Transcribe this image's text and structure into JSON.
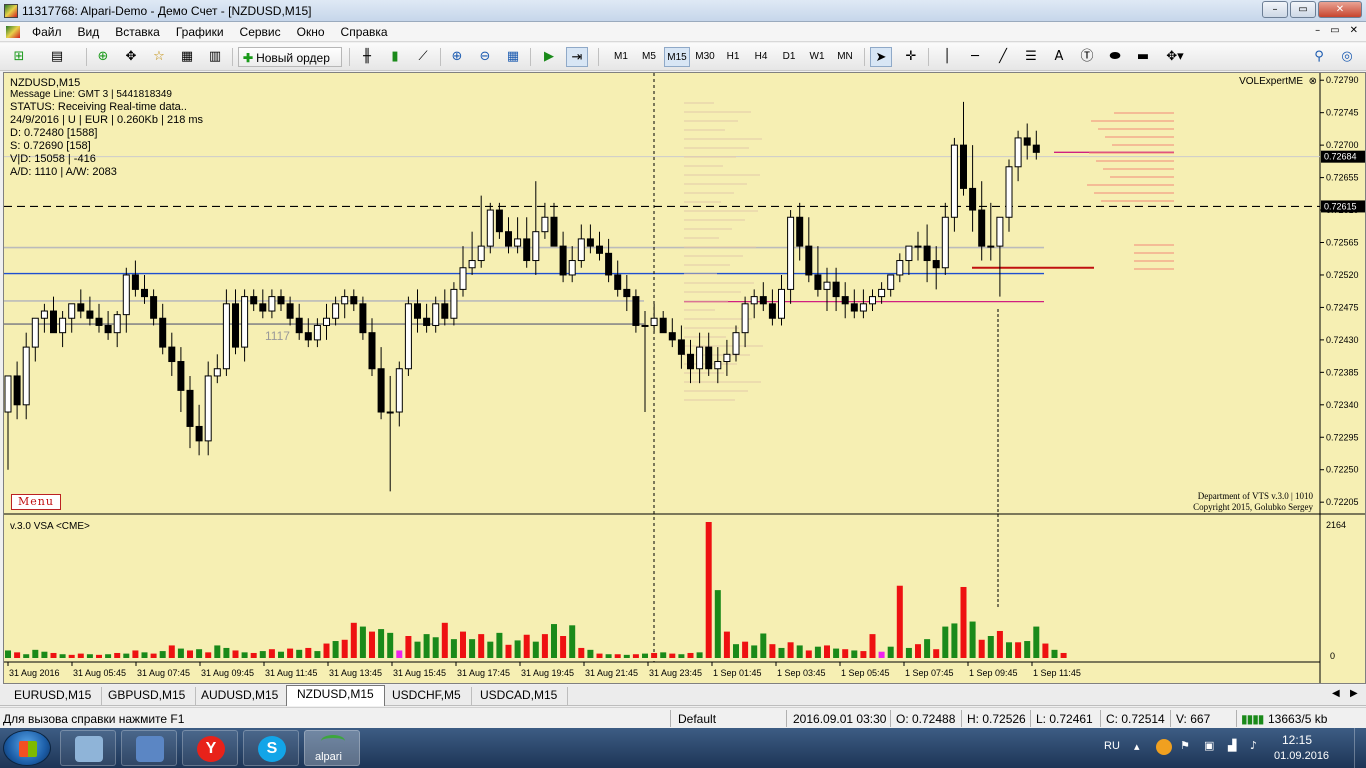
{
  "window": {
    "title": "11317768: Alpari-Demo - Демо Счет - [NZDUSD,M15]",
    "minimize": "–",
    "restore": "▭",
    "close": "✕"
  },
  "menu": {
    "items": [
      "Файл",
      "Вид",
      "Вставка",
      "Графики",
      "Сервис",
      "Окно",
      "Справка"
    ],
    "mdi_minimize": "–",
    "mdi_restore": "▭",
    "mdi_close": "✕"
  },
  "toolbar": {
    "new_order": "Новый ордер",
    "timeframes": [
      "M1",
      "M5",
      "M15",
      "M30",
      "H1",
      "H4",
      "D1",
      "W1",
      "MN"
    ],
    "active_timeframe": "M15",
    "text_tool": "A"
  },
  "chart": {
    "info_lines": [
      "NZDUSD,M15",
      "Message Line: GMT 3 | 5441818349",
      "STATUS:  Receiving Real-time data..",
      "24/9/2016 | U | EUR | 0.260Kb | 218 ms",
      "D: 0.72480  [1588]",
      "S: 0.72690  [158]",
      "V|D: 15058 | -416",
      "A/D: 1110 | A/W: 2083"
    ],
    "menu_button": "Menu",
    "volexpert": "VOLExpertME",
    "volexpert_close": "⊗",
    "vts_line1": "Department of VTS  v.3.0 | 1010",
    "vts_line2": "Copyright 2015, Golubko Sergey",
    "indicator_label": "v.3.0 VSA <CME>",
    "level_label": "1117",
    "current_price": "0.72684",
    "line_price": "0.72615",
    "price_ticks": [
      "0.72790",
      "0.72745",
      "0.72700",
      "0.72655",
      "0.72610",
      "0.72565",
      "0.72520",
      "0.72475",
      "0.72430",
      "0.72385",
      "0.72340",
      "0.72295",
      "0.72250",
      "0.72205"
    ],
    "volume_max_label": "2164",
    "volume_min_label": "0",
    "time_labels": [
      "31 Aug 2016",
      "31 Aug 05:45",
      "31 Aug 07:45",
      "31 Aug 09:45",
      "31 Aug 11:45",
      "31 Aug 13:45",
      "31 Aug 15:45",
      "31 Aug 17:45",
      "31 Aug 19:45",
      "31 Aug 21:45",
      "31 Aug 23:45",
      "1 Sep 01:45",
      "1 Sep 03:45",
      "1 Sep 05:45",
      "1 Sep 07:45",
      "1 Sep 09:45",
      "1 Sep 11:45"
    ],
    "colors": {
      "background": "#f6efb3",
      "bull_volume": "#1a8a1a",
      "bear_volume": "#ee1111",
      "special_volume": "#ee22ee",
      "blue_level": "#1f4fd0",
      "magenta_level": "#d02080",
      "red_level": "#c01010",
      "gray_level": "#999999"
    }
  },
  "chart_data": {
    "type": "candlestick",
    "symbol": "NZDUSD",
    "timeframe": "M15",
    "ylim": [
      0.7219,
      0.728
    ],
    "grid": false,
    "candles": {
      "open": [
        0.7233,
        0.7238,
        0.7234,
        0.7242,
        0.7246,
        0.7247,
        0.7244,
        0.7246,
        0.7248,
        0.7247,
        0.7246,
        0.7245,
        0.7244,
        0.72465,
        0.7252,
        0.725,
        0.7249,
        0.7246,
        0.7242,
        0.724,
        0.7236,
        0.7231,
        0.7229,
        0.7238,
        0.7239,
        0.7248,
        0.7242,
        0.7249,
        0.7248,
        0.7247,
        0.7249,
        0.7248,
        0.7246,
        0.7244,
        0.7243,
        0.7245,
        0.7246,
        0.7248,
        0.7249,
        0.7248,
        0.7244,
        0.7239,
        0.7233,
        0.7233,
        0.7239,
        0.7248,
        0.7246,
        0.7245,
        0.7248,
        0.7246,
        0.725,
        0.7253,
        0.7254,
        0.7256,
        0.7261,
        0.7258,
        0.7256,
        0.7257,
        0.7254,
        0.7258,
        0.726,
        0.7256,
        0.7252,
        0.7254,
        0.7257,
        0.7256,
        0.7255,
        0.7252,
        0.725,
        0.7249,
        0.7245,
        0.7245,
        0.7246,
        0.7244,
        0.7243,
        0.7241,
        0.7239,
        0.7242,
        0.7239,
        0.724,
        0.7241,
        0.7244,
        0.7248,
        0.7249,
        0.7248,
        0.7246,
        0.725,
        0.726,
        0.7256,
        0.7252,
        0.725,
        0.7251,
        0.7249,
        0.7248,
        0.7247,
        0.7248,
        0.7249,
        0.725,
        0.7252,
        0.7254,
        0.7256,
        0.7256,
        0.7254,
        0.7253,
        0.726,
        0.727,
        0.7264,
        0.7261,
        0.7256,
        0.7256,
        0.726,
        0.7267,
        0.7271,
        0.727
      ],
      "high": [
        0.7235,
        0.724,
        0.7244,
        0.7246,
        0.7248,
        0.7249,
        0.7247,
        0.7248,
        0.725,
        0.7249,
        0.7248,
        0.7247,
        0.7247,
        0.7253,
        0.7254,
        0.7252,
        0.725,
        0.7248,
        0.7244,
        0.7242,
        0.7238,
        0.7234,
        0.724,
        0.7241,
        0.725,
        0.725,
        0.725,
        0.725,
        0.725,
        0.725,
        0.725,
        0.7249,
        0.7248,
        0.7246,
        0.7246,
        0.7248,
        0.7249,
        0.725,
        0.725,
        0.7249,
        0.7246,
        0.7242,
        0.7238,
        0.724,
        0.7249,
        0.725,
        0.7248,
        0.7249,
        0.725,
        0.7251,
        0.7256,
        0.7258,
        0.7263,
        0.7262,
        0.7262,
        0.726,
        0.726,
        0.726,
        0.7265,
        0.7262,
        0.7262,
        0.7258,
        0.7256,
        0.7259,
        0.7259,
        0.7258,
        0.7257,
        0.7254,
        0.7252,
        0.725,
        0.7247,
        0.7248,
        0.7247,
        0.7246,
        0.7245,
        0.7243,
        0.7244,
        0.7244,
        0.7242,
        0.7243,
        0.7245,
        0.7249,
        0.725,
        0.7251,
        0.725,
        0.7252,
        0.7261,
        0.7262,
        0.726,
        0.7256,
        0.7253,
        0.7253,
        0.7251,
        0.725,
        0.725,
        0.725,
        0.7251,
        0.7252,
        0.7255,
        0.7256,
        0.7258,
        0.7259,
        0.7256,
        0.7262,
        0.7271,
        0.7276,
        0.727,
        0.7265,
        0.7262,
        0.7258,
        0.7268,
        0.7272,
        0.7273,
        0.7272
      ],
      "low": [
        0.7225,
        0.7232,
        0.7232,
        0.724,
        0.7244,
        0.7244,
        0.7242,
        0.7244,
        0.7246,
        0.7245,
        0.7244,
        0.7243,
        0.7242,
        0.7244,
        0.7249,
        0.7248,
        0.7245,
        0.7241,
        0.7238,
        0.7233,
        0.7228,
        0.7227,
        0.7227,
        0.7237,
        0.7238,
        0.7241,
        0.724,
        0.7247,
        0.7246,
        0.7246,
        0.7247,
        0.7245,
        0.7243,
        0.7242,
        0.7242,
        0.7243,
        0.7245,
        0.7246,
        0.7247,
        0.7243,
        0.7238,
        0.7232,
        0.7222,
        0.7231,
        0.7238,
        0.7244,
        0.7244,
        0.7244,
        0.7245,
        0.7245,
        0.7249,
        0.7252,
        0.7253,
        0.7255,
        0.7257,
        0.7255,
        0.7255,
        0.7253,
        0.7252,
        0.7257,
        0.7256,
        0.7251,
        0.7251,
        0.7253,
        0.7255,
        0.7254,
        0.7251,
        0.7249,
        0.7247,
        0.7244,
        0.7233,
        0.7244,
        0.7244,
        0.7242,
        0.7239,
        0.7237,
        0.7237,
        0.7238,
        0.7237,
        0.7238,
        0.724,
        0.7242,
        0.7246,
        0.7247,
        0.7245,
        0.7245,
        0.7248,
        0.7254,
        0.7251,
        0.7249,
        0.7247,
        0.7247,
        0.7246,
        0.7246,
        0.7246,
        0.7247,
        0.7248,
        0.7249,
        0.7251,
        0.7252,
        0.7254,
        0.7251,
        0.725,
        0.7252,
        0.7258,
        0.7263,
        0.7258,
        0.7254,
        0.7254,
        0.7249,
        0.7258,
        0.7265,
        0.7268,
        0.7268
      ],
      "close": [
        0.7238,
        0.7234,
        0.7242,
        0.7246,
        0.7247,
        0.7244,
        0.7246,
        0.7248,
        0.7247,
        0.7246,
        0.7245,
        0.7244,
        0.72465,
        0.7252,
        0.725,
        0.7249,
        0.7246,
        0.7242,
        0.724,
        0.7236,
        0.7231,
        0.7229,
        0.7238,
        0.7239,
        0.7248,
        0.7242,
        0.7249,
        0.7248,
        0.7247,
        0.7249,
        0.7248,
        0.7246,
        0.7244,
        0.7243,
        0.7245,
        0.7246,
        0.7248,
        0.7249,
        0.7248,
        0.7244,
        0.7239,
        0.7233,
        0.7233,
        0.7239,
        0.7248,
        0.7246,
        0.7245,
        0.7248,
        0.7246,
        0.725,
        0.7253,
        0.7254,
        0.7256,
        0.7261,
        0.7258,
        0.7256,
        0.7257,
        0.7254,
        0.7258,
        0.726,
        0.7256,
        0.7252,
        0.7254,
        0.7257,
        0.7256,
        0.7255,
        0.7252,
        0.725,
        0.7249,
        0.7245,
        0.7245,
        0.7246,
        0.7244,
        0.7243,
        0.7241,
        0.7239,
        0.7242,
        0.7239,
        0.724,
        0.7241,
        0.7244,
        0.7248,
        0.7249,
        0.7248,
        0.7246,
        0.725,
        0.726,
        0.7256,
        0.7252,
        0.725,
        0.7251,
        0.7249,
        0.7248,
        0.7247,
        0.7248,
        0.7249,
        0.725,
        0.7252,
        0.7254,
        0.7256,
        0.7256,
        0.7254,
        0.7253,
        0.726,
        0.727,
        0.7264,
        0.7261,
        0.7256,
        0.7256,
        0.726,
        0.7267,
        0.7271,
        0.727,
        0.7269
      ]
    },
    "volume": [
      {
        "v": 120,
        "c": "green"
      },
      {
        "v": 90,
        "c": "red"
      },
      {
        "v": 60,
        "c": "green"
      },
      {
        "v": 130,
        "c": "green"
      },
      {
        "v": 100,
        "c": "green"
      },
      {
        "v": 80,
        "c": "red"
      },
      {
        "v": 60,
        "c": "green"
      },
      {
        "v": 50,
        "c": "red"
      },
      {
        "v": 70,
        "c": "red"
      },
      {
        "v": 60,
        "c": "green"
      },
      {
        "v": 50,
        "c": "red"
      },
      {
        "v": 60,
        "c": "green"
      },
      {
        "v": 80,
        "c": "red"
      },
      {
        "v": 70,
        "c": "green"
      },
      {
        "v": 120,
        "c": "red"
      },
      {
        "v": 90,
        "c": "green"
      },
      {
        "v": 70,
        "c": "red"
      },
      {
        "v": 110,
        "c": "green"
      },
      {
        "v": 200,
        "c": "red"
      },
      {
        "v": 150,
        "c": "green"
      },
      {
        "v": 120,
        "c": "red"
      },
      {
        "v": 140,
        "c": "green"
      },
      {
        "v": 90,
        "c": "red"
      },
      {
        "v": 200,
        "c": "green"
      },
      {
        "v": 160,
        "c": "green"
      },
      {
        "v": 120,
        "c": "red"
      },
      {
        "v": 90,
        "c": "green"
      },
      {
        "v": 80,
        "c": "red"
      },
      {
        "v": 110,
        "c": "green"
      },
      {
        "v": 140,
        "c": "red"
      },
      {
        "v": 100,
        "c": "green"
      },
      {
        "v": 150,
        "c": "red"
      },
      {
        "v": 130,
        "c": "green"
      },
      {
        "v": 160,
        "c": "red"
      },
      {
        "v": 110,
        "c": "green"
      },
      {
        "v": 230,
        "c": "red"
      },
      {
        "v": 270,
        "c": "green"
      },
      {
        "v": 290,
        "c": "red"
      },
      {
        "v": 560,
        "c": "red"
      },
      {
        "v": 500,
        "c": "green"
      },
      {
        "v": 420,
        "c": "red"
      },
      {
        "v": 460,
        "c": "green"
      },
      {
        "v": 400,
        "c": "green"
      },
      {
        "v": 120,
        "c": "magenta"
      },
      {
        "v": 350,
        "c": "red"
      },
      {
        "v": 260,
        "c": "green"
      },
      {
        "v": 380,
        "c": "green"
      },
      {
        "v": 330,
        "c": "green"
      },
      {
        "v": 560,
        "c": "red"
      },
      {
        "v": 300,
        "c": "green"
      },
      {
        "v": 420,
        "c": "red"
      },
      {
        "v": 300,
        "c": "green"
      },
      {
        "v": 380,
        "c": "red"
      },
      {
        "v": 260,
        "c": "green"
      },
      {
        "v": 400,
        "c": "green"
      },
      {
        "v": 210,
        "c": "red"
      },
      {
        "v": 280,
        "c": "green"
      },
      {
        "v": 370,
        "c": "red"
      },
      {
        "v": 260,
        "c": "green"
      },
      {
        "v": 380,
        "c": "red"
      },
      {
        "v": 540,
        "c": "green"
      },
      {
        "v": 350,
        "c": "red"
      },
      {
        "v": 520,
        "c": "green"
      },
      {
        "v": 160,
        "c": "red"
      },
      {
        "v": 130,
        "c": "green"
      },
      {
        "v": 70,
        "c": "red"
      },
      {
        "v": 60,
        "c": "green"
      },
      {
        "v": 60,
        "c": "red"
      },
      {
        "v": 50,
        "c": "green"
      },
      {
        "v": 60,
        "c": "red"
      },
      {
        "v": 70,
        "c": "green"
      },
      {
        "v": 80,
        "c": "red"
      },
      {
        "v": 90,
        "c": "green"
      },
      {
        "v": 70,
        "c": "red"
      },
      {
        "v": 60,
        "c": "green"
      },
      {
        "v": 80,
        "c": "red"
      },
      {
        "v": 90,
        "c": "green"
      },
      {
        "v": 2164,
        "c": "red"
      },
      {
        "v": 1080,
        "c": "green"
      },
      {
        "v": 420,
        "c": "red"
      },
      {
        "v": 220,
        "c": "green"
      },
      {
        "v": 260,
        "c": "red"
      },
      {
        "v": 200,
        "c": "green"
      },
      {
        "v": 390,
        "c": "green"
      },
      {
        "v": 220,
        "c": "red"
      },
      {
        "v": 160,
        "c": "green"
      },
      {
        "v": 250,
        "c": "red"
      },
      {
        "v": 200,
        "c": "green"
      },
      {
        "v": 120,
        "c": "red"
      },
      {
        "v": 180,
        "c": "green"
      },
      {
        "v": 200,
        "c": "red"
      },
      {
        "v": 150,
        "c": "green"
      },
      {
        "v": 140,
        "c": "red"
      },
      {
        "v": 120,
        "c": "green"
      },
      {
        "v": 110,
        "c": "red"
      },
      {
        "v": 380,
        "c": "red"
      },
      {
        "v": 100,
        "c": "magenta"
      },
      {
        "v": 180,
        "c": "green"
      },
      {
        "v": 1150,
        "c": "red"
      },
      {
        "v": 160,
        "c": "green"
      },
      {
        "v": 220,
        "c": "red"
      },
      {
        "v": 300,
        "c": "green"
      },
      {
        "v": 140,
        "c": "red"
      },
      {
        "v": 500,
        "c": "green"
      },
      {
        "v": 550,
        "c": "green"
      },
      {
        "v": 1130,
        "c": "red"
      },
      {
        "v": 580,
        "c": "green"
      },
      {
        "v": 290,
        "c": "red"
      },
      {
        "v": 350,
        "c": "green"
      },
      {
        "v": 430,
        "c": "red"
      },
      {
        "v": 250,
        "c": "green"
      },
      {
        "v": 250,
        "c": "red"
      },
      {
        "v": 270,
        "c": "green"
      },
      {
        "v": 500,
        "c": "green"
      },
      {
        "v": 230,
        "c": "red"
      },
      {
        "v": 130,
        "c": "green"
      },
      {
        "v": 80,
        "c": "red"
      }
    ],
    "volume_ylim": [
      0,
      2164
    ],
    "levels": [
      {
        "price": 0.72615,
        "style": "dashed",
        "color": "black"
      },
      {
        "price": 0.72522,
        "style": "solid",
        "color": "blue"
      },
      {
        "price": 0.72483,
        "style": "solid",
        "color": "magenta"
      },
      {
        "price": 0.72452,
        "style": "solid",
        "color": "gray"
      },
      {
        "price": 0.72558,
        "style": "solid",
        "color": "gray"
      },
      {
        "price": 0.72484,
        "style": "solid",
        "color": "gray"
      },
      {
        "price": 0.72684,
        "style": "solid",
        "color": "gray"
      },
      {
        "price": 0.7253,
        "style": "solid",
        "color": "red"
      },
      {
        "price": 0.7269,
        "style": "solid",
        "color": "magenta"
      }
    ]
  },
  "tabs": {
    "items": [
      "EURUSD,M15",
      "GBPUSD,M15",
      "AUDUSD,M15",
      "NZDUSD,M15",
      "USDCHF,M5",
      "USDCAD,M15"
    ],
    "active": "NZDUSD,M15",
    "scroll_left": "◀",
    "scroll_right": "▶"
  },
  "statusbar": {
    "help": "Для вызова справки нажмите F1",
    "profile": "Default",
    "datetime": "2016.09.01 03:30",
    "open": "O: 0.72488",
    "high": "H: 0.72526",
    "low": "L: 0.72461",
    "close": "C: 0.72514",
    "volume": "V: 667",
    "connection": "13663/5 kb"
  },
  "taskbar": {
    "start_label": "Start",
    "tasks": [
      {
        "name": "calculator",
        "label": ""
      },
      {
        "name": "remote",
        "label": ""
      },
      {
        "name": "yandex",
        "label": "Y"
      },
      {
        "name": "skype",
        "label": "S"
      },
      {
        "name": "alpari",
        "label": "alpari"
      }
    ],
    "language": "RU",
    "time": "12:15",
    "date": "01.09.2016"
  }
}
